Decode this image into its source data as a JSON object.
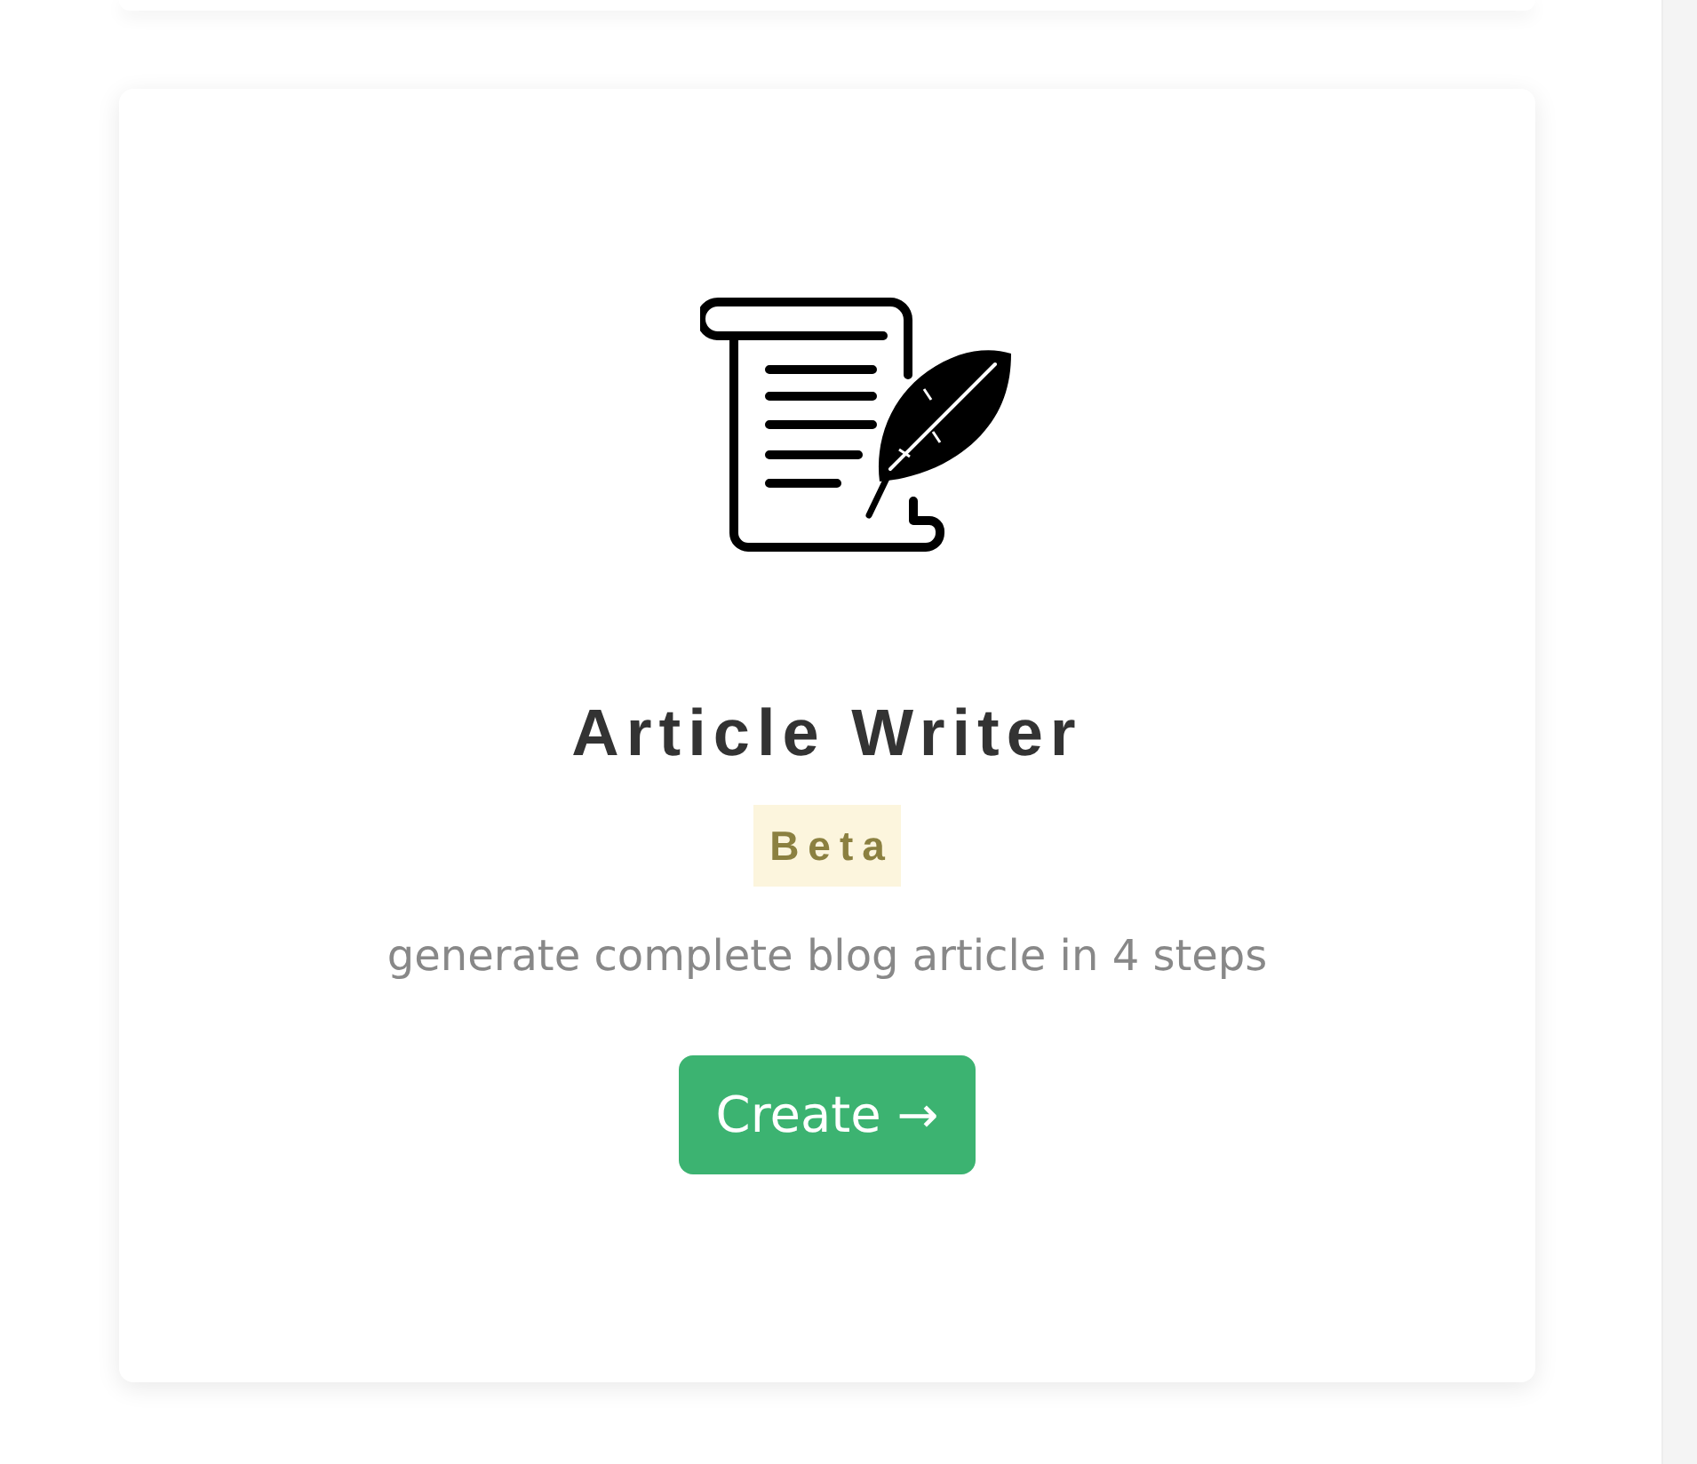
{
  "tool_card": {
    "title": "Article Writer",
    "badge": "Beta",
    "description": "generate complete blog article in 4 steps",
    "button": {
      "label": "Create →"
    }
  }
}
